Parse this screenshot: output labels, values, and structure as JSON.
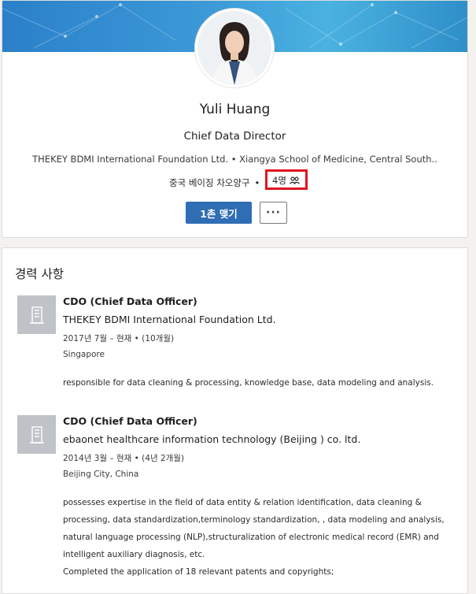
{
  "profile": {
    "name": "Yuli Huang",
    "headline": "Chief Data Director",
    "organizations": "THEKEY BDMI International Foundation Ltd. • Xiangya School of Medicine, Central South..",
    "location": "중국 베이징 차오양구",
    "separator": "•",
    "connections": "4명",
    "connect_button": "1촌 맺기",
    "more_button": "···"
  },
  "experience": {
    "section_title": "경력 사항",
    "items": [
      {
        "title": "CDO (Chief Data Officer)",
        "company": "THEKEY BDMI International Foundation Ltd.",
        "dates": "2017년 7월 – 현재 • (10개월)",
        "location": "Singapore",
        "description": [
          "responsible for data cleaning & processing, knowledge base, data modeling and analysis."
        ]
      },
      {
        "title": "CDO (Chief Data Officer)",
        "company": "ebaonet healthcare information technology (Beijing ) co. ltd.",
        "dates": "2014년 3월 – 현재 • (4년 2개월)",
        "location": "Beijing City, China",
        "description": [
          "possesses expertise in the field of data entity & relation identification, data cleaning &",
          "processing, data standardization,terminology standardization, , data modeling and analysis,",
          "natural language processing (NLP),structuralization of electronic medical record (EMR) and",
          "intelligent auxiliary diagnosis, etc.",
          "Completed the application of 18 relevant patents and copyrights;"
        ]
      }
    ]
  },
  "colors": {
    "primary_button": "#2f6db5",
    "highlight": "#e0161f",
    "banner": "#3c9ad8",
    "logo_placeholder": "#bfc3c8"
  },
  "icons": {
    "connections": "people-icon",
    "company_logo": "building-icon"
  }
}
